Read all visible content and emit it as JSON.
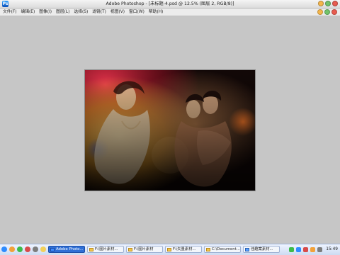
{
  "window": {
    "title": "Adobe Photoshop - [未标题-4.psd @ 12.5% (图层 2, RGB/8)]"
  },
  "menu": {
    "items": [
      {
        "label": "文件(F)"
      },
      {
        "label": "编辑(E)"
      },
      {
        "label": "图像(I)"
      },
      {
        "label": "图层(L)"
      },
      {
        "label": "选择(S)"
      },
      {
        "label": "滤镜(T)"
      },
      {
        "label": "视图(V)"
      },
      {
        "label": "窗口(W)"
      },
      {
        "label": "帮助(H)"
      }
    ]
  },
  "canvas": {
    "zoom": "12.5%"
  },
  "taskbar": {
    "tasks": [
      {
        "label": "Adobe Photo...",
        "active": true
      },
      {
        "label": "F:\\图片素材...",
        "active": false
      },
      {
        "label": "F:\\图片素材",
        "active": false
      },
      {
        "label": "F:\\矢量素材...",
        "active": false
      },
      {
        "label": "C:\\Document...",
        "active": false
      },
      {
        "label": "佳趣案素材...",
        "active": false
      }
    ],
    "clock": "15:49"
  },
  "colors": {
    "workspace": "#c6c6c6",
    "taskbar_active": "#2f6fd6"
  }
}
